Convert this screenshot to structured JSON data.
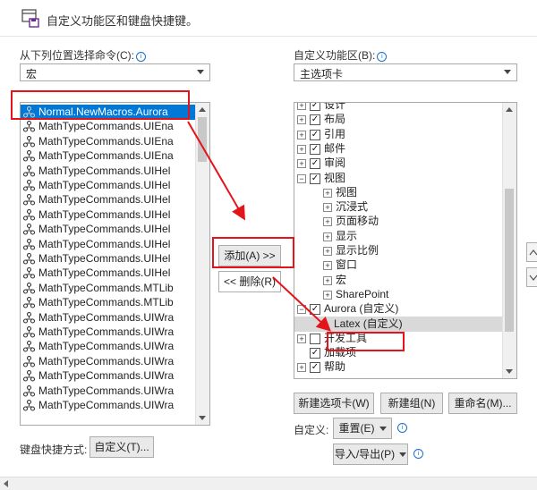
{
  "header": {
    "title": "自定义功能区和键盘快捷键。"
  },
  "left": {
    "choose_label": "从下列位置选择命令(C):",
    "choose_value": "宏",
    "commands": [
      "Normal.NewMacros.Aurora",
      "MathTypeCommands.UIEna",
      "MathTypeCommands.UIEna",
      "MathTypeCommands.UIEna",
      "MathTypeCommands.UIHel",
      "MathTypeCommands.UIHel",
      "MathTypeCommands.UIHel",
      "MathTypeCommands.UIHel",
      "MathTypeCommands.UIHel",
      "MathTypeCommands.UIHel",
      "MathTypeCommands.UIHel",
      "MathTypeCommands.UIHel",
      "MathTypeCommands.MTLib",
      "MathTypeCommands.MTLib",
      "MathTypeCommands.UIWra",
      "MathTypeCommands.UIWra",
      "MathTypeCommands.UIWra",
      "MathTypeCommands.UIWra",
      "MathTypeCommands.UIWra",
      "MathTypeCommands.UIWra",
      "MathTypeCommands.UIWra"
    ],
    "shortcut_label": "键盘快捷方式:",
    "customize_button": "自定义(T)..."
  },
  "middle": {
    "add_button": "添加(A) >>",
    "remove_button": "<< 删除(R)"
  },
  "right": {
    "ribbon_label": "自定义功能区(B):",
    "ribbon_value": "主选项卡",
    "tree": [
      {
        "label": "设计",
        "level": 0,
        "expander": "+",
        "checked": true
      },
      {
        "label": "布局",
        "level": 0,
        "expander": "+",
        "checked": true
      },
      {
        "label": "引用",
        "level": 0,
        "expander": "+",
        "checked": true
      },
      {
        "label": "邮件",
        "level": 0,
        "expander": "+",
        "checked": true
      },
      {
        "label": "审阅",
        "level": 0,
        "expander": "+",
        "checked": true
      },
      {
        "label": "视图",
        "level": 0,
        "expander": "−",
        "checked": true
      },
      {
        "label": "视图",
        "level": 1,
        "expander": "+"
      },
      {
        "label": "沉浸式",
        "level": 1,
        "expander": "+"
      },
      {
        "label": "页面移动",
        "level": 1,
        "expander": "+"
      },
      {
        "label": "显示",
        "level": 1,
        "expander": "+"
      },
      {
        "label": "显示比例",
        "level": 1,
        "expander": "+"
      },
      {
        "label": "窗口",
        "level": 1,
        "expander": "+"
      },
      {
        "label": "宏",
        "level": 1,
        "expander": "+"
      },
      {
        "label": "SharePoint",
        "level": 1,
        "expander": "+"
      },
      {
        "label": "Aurora (自定义)",
        "level": 0,
        "expander": "−",
        "checked": true
      },
      {
        "label": "Latex (自定义)",
        "level": 1,
        "expander": "",
        "selected": true
      },
      {
        "label": "开发工具",
        "level": 0,
        "expander": "+",
        "checked": false
      },
      {
        "label": "加载项",
        "level": 0,
        "expander": "",
        "checked": true
      },
      {
        "label": "帮助",
        "level": 0,
        "expander": "+",
        "checked": true
      }
    ],
    "new_tab_button": "新建选项卡(W)",
    "new_group_button": "新建组(N)",
    "rename_button": "重命名(M)...",
    "customize_label": "自定义:",
    "reset_button": "重置(E)",
    "import_export_button": "导入/导出(P)"
  },
  "colors": {
    "highlight": "#0078d7",
    "annotation": "#e4141b",
    "selected_row": "#d9d9d9"
  }
}
